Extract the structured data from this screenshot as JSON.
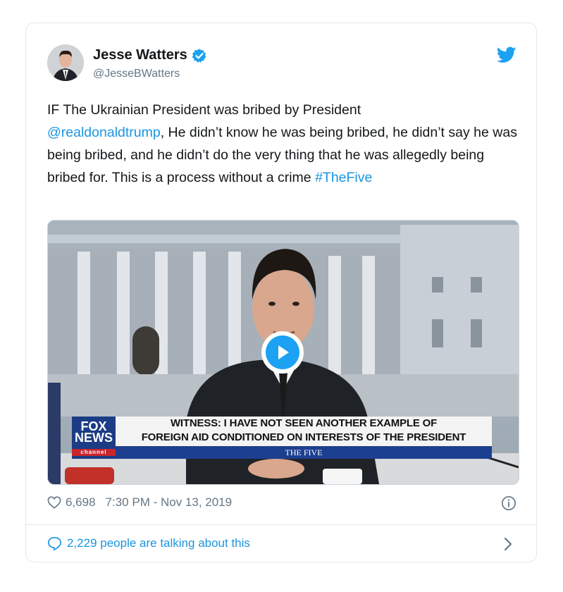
{
  "author": {
    "name": "Jesse Watters",
    "handle": "@JesseBWatters"
  },
  "tweet": {
    "text_part1": "IF The Ukrainian President was bribed by President",
    "mention": "@realdonaldtrump",
    "text_part2": ", He didn’t know he was being bribed, he didn’t say he was being bribed, and he didn’t do the very thing that he was allegedly being bribed for. This is a process without a crime ",
    "hashtag": "#TheFive"
  },
  "media": {
    "logo_line1": "FOX",
    "logo_line2": "NEWS",
    "logo_sub": "channel",
    "chyron_line1": "WITNESS: I HAVE NOT SEEN ANOTHER EXAMPLE OF",
    "chyron_line2": "FOREIGN AID CONDITIONED ON INTERESTS OF THE PRESIDENT",
    "show_name": "THE FIVE"
  },
  "footer": {
    "likes": "6,698",
    "timestamp": "7:30 PM - Nov 13, 2019",
    "talking": "2,229 people are talking about this"
  },
  "icons": [
    "verified-badge-icon",
    "twitter-bird-icon",
    "play-icon",
    "heart-icon",
    "info-icon",
    "reply-bubble-icon",
    "chevron-right-icon"
  ],
  "colors": {
    "link": "#1b95e0",
    "verified": "#1da1f2",
    "secondary_text": "#657786",
    "fox_blue": "#1c3c86"
  }
}
